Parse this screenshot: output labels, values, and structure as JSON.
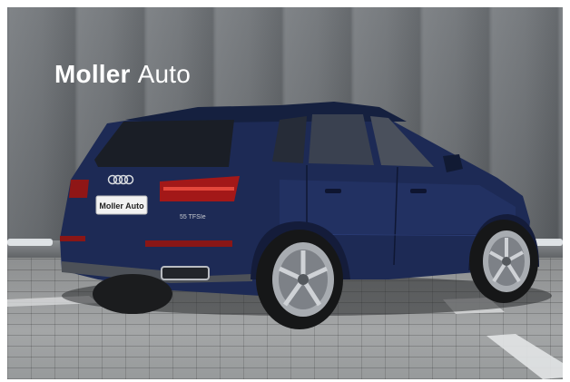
{
  "watermark": {
    "brand": "Moller",
    "word": "Auto"
  },
  "plate": {
    "text": "Moller Auto"
  },
  "badge": {
    "model": "55 TFSIe"
  },
  "colors": {
    "car_body": "#1d2a55",
    "wall": "#6f7377",
    "pavement": "#9a9c9d",
    "watermark": "#ffffff"
  }
}
